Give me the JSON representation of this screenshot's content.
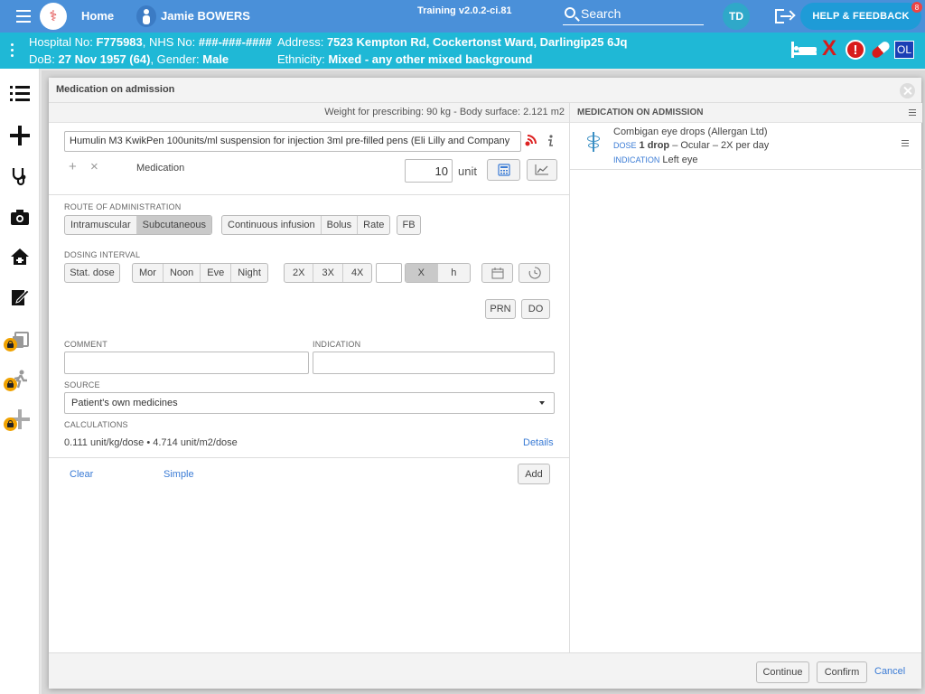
{
  "topbar": {
    "home_label": "Home",
    "patient_name": "Jamie BOWERS",
    "version": "Training v2.0.2-ci.81",
    "search_label": "Search",
    "user_initials": "TD",
    "help_label": "HELP & FEEDBACK",
    "help_badge": "8"
  },
  "banner": {
    "hospital_label": "Hospital No:",
    "hospital_no": "F775983",
    "nhs_label": ", NHS No:",
    "nhs_no": "###-###-####",
    "dob_label": "DoB:",
    "dob": "27 Nov 1957 (64)",
    "gender_label": ", Gender:",
    "gender": "Male",
    "address_label": "Address:",
    "address": "7523 Kempton Rd, Cockertonst Ward, Darlingip25 6Jq",
    "ethnicity_label": "Ethnicity:",
    "ethnicity": "Mixed - any other mixed background",
    "ol_label": "OL",
    "alert_label": "!",
    "x_label": "X"
  },
  "modal": {
    "title": "Medication on admission",
    "weight_text": "Weight for prescribing: 90 kg - Body surface: 2.121 m2",
    "medication_value": "Humulin M3 KwikPen 100units/ml suspension for injection 3ml pre-filled pens (Eli Lilly and Company",
    "medication_label": "Medication",
    "plus": "+",
    "cross": "×",
    "quantity": "10",
    "unit": "unit",
    "route_label": "ROUTE OF ADMINISTRATION",
    "route_options": [
      "Intramuscular",
      "Subcutaneous"
    ],
    "route_options2": [
      "Continuous infusion",
      "Bolus",
      "Rate"
    ],
    "fb_label": "FB",
    "dosing_label": "DOSING INTERVAL",
    "stat_dose": "Stat. dose",
    "times": [
      "Mor",
      "Noon",
      "Eve",
      "Night"
    ],
    "freqs": [
      "2X",
      "3X",
      "4X"
    ],
    "interval_x": "X",
    "interval_h": "h",
    "prn": "PRN",
    "do": "DO",
    "comment_label": "COMMENT",
    "indication_label": "INDICATION",
    "source_label": "SOURCE",
    "source_value": "Patient's own medicines",
    "calc_label": "CALCULATIONS",
    "calc_value": "0.111 unit/kg/dose • 4.714 unit/m2/dose",
    "details_link": "Details",
    "clear_link": "Clear",
    "simple_link": "Simple",
    "add_button": "Add",
    "right_title": "MEDICATION ON ADMISSION",
    "item": {
      "name": "Combigan eye drops (Allergan Ltd)",
      "dose_tag": "DOSE",
      "dose_amount": "1 drop",
      "dose_rest": " – Ocular – 2X per day",
      "ind_tag": "INDICATION",
      "ind_value": "Left eye"
    },
    "continue_button": "Continue",
    "confirm_button": "Confirm",
    "cancel_link": "Cancel"
  },
  "colors": {
    "topbar": "#4a90d9",
    "banner": "#1fb8d6",
    "alert": "#d81b1b",
    "link": "#3a7bd5"
  }
}
